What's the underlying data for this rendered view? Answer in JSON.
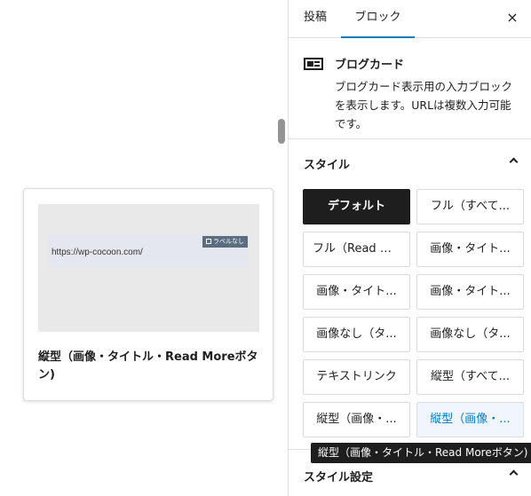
{
  "preview": {
    "url": "https://wp-cocoon.com/",
    "label": "ラベルなし",
    "caption": "縦型（画像・タイトル・Read Moreボタン)"
  },
  "tabs": {
    "post": "投稿",
    "block": "ブロック"
  },
  "close_icon": "×",
  "block": {
    "icon": "card-icon",
    "title": "ブログカード",
    "description": "ブログカード表示用の入力ブロックを表示します。URLは複数入力可能です。"
  },
  "styles": {
    "header": "スタイル",
    "options": [
      {
        "label": "デフォルト",
        "state": "active"
      },
      {
        "label": "フル（すべて...",
        "state": ""
      },
      {
        "label": "フル（Read M...",
        "state": ""
      },
      {
        "label": "画像・タイト...",
        "state": ""
      },
      {
        "label": "画像・タイト...",
        "state": ""
      },
      {
        "label": "画像・タイト...",
        "state": ""
      },
      {
        "label": "画像なし（タ...",
        "state": ""
      },
      {
        "label": "画像なし（タ...",
        "state": ""
      },
      {
        "label": "テキストリンク",
        "state": ""
      },
      {
        "label": "縦型（すべて...",
        "state": ""
      },
      {
        "label": "縦型（画像・...",
        "state": ""
      },
      {
        "label": "縦型（画像・...",
        "state": "hover"
      }
    ],
    "tooltip": "縦型（画像・タイトル・Read Moreボタン)"
  },
  "style_settings": {
    "header": "スタイル設定"
  },
  "colors": {
    "accent": "#007cba",
    "active_bg": "#1e1e1e",
    "label_bg": "#5b6d80"
  }
}
